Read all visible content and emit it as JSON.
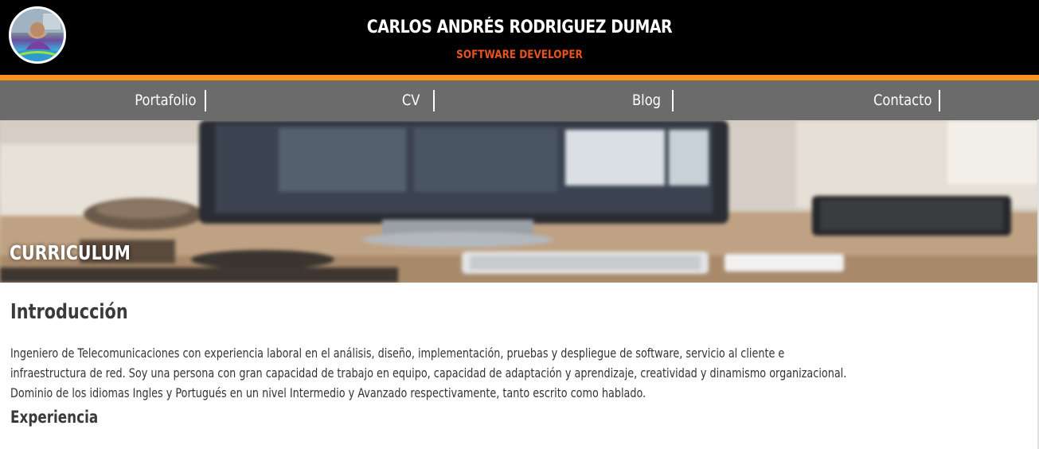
{
  "header": {
    "name": "CARLOS ANDRÉS RODRIGUEZ DUMAR",
    "role": "SOFTWARE DEVELOPER",
    "role_color": "#e8531e",
    "accent_bar_color": "#f7941d"
  },
  "nav": {
    "items": [
      {
        "label": "Portafolio"
      },
      {
        "label": "CV"
      },
      {
        "label": "Blog"
      },
      {
        "label": "Contacto"
      }
    ]
  },
  "hero": {
    "title": "CURRICULUM"
  },
  "main": {
    "intro_heading": "Introducción",
    "intro_text": "Ingeniero de Telecomunicaciones con experiencia laboral en el análisis, diseño, implementación, pruebas y despliegue de software, servicio al cliente e infraestructura de red. Soy una persona con gran capacidad de trabajo en equipo, capacidad de adaptación y aprendizaje, creatividad y dinamismo organizacional. Dominio de los idiomas Ingles y Portugués en un nivel Intermedio y Avanzado respectivamente, tanto escrito como hablado.",
    "experience_heading": "Experiencia"
  }
}
